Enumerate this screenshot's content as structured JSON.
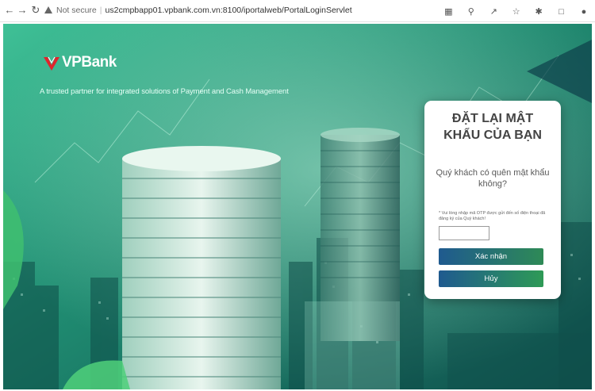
{
  "browser": {
    "security_label": "Not secure",
    "url": "us2cmpbapp01.vpbank.com.vn:8100/iportalweb/PortalLoginServlet",
    "icons": [
      "back-icon",
      "forward-icon",
      "reload-icon",
      "translate-icon",
      "zoom-icon",
      "share-icon",
      "bookmark-star-icon",
      "extensions-icon",
      "sidepanel-icon",
      "profile-icon"
    ]
  },
  "brand": {
    "logo_text": "VPBank",
    "tagline": "A trusted partner for integrated solutions of Payment and Cash Management",
    "logo_color": "#e0242c"
  },
  "reset": {
    "title_line1": "ĐẶT LẠI MẬT",
    "title_line2": "KHẨU CỦA BẠN",
    "question": "Quý khách có quên mật khẩu không?",
    "instruction": "* Vui lòng nhập mã OTP được gửi đến số điện thoại đã đăng ký của Quý khách!",
    "otp_value": "",
    "confirm_label": "Xác nhận",
    "cancel_label": "Hủy"
  },
  "colors": {
    "hero_green": "#2a8f77",
    "button_blue": "#1f5a8f",
    "button_green": "#2e8a56"
  }
}
